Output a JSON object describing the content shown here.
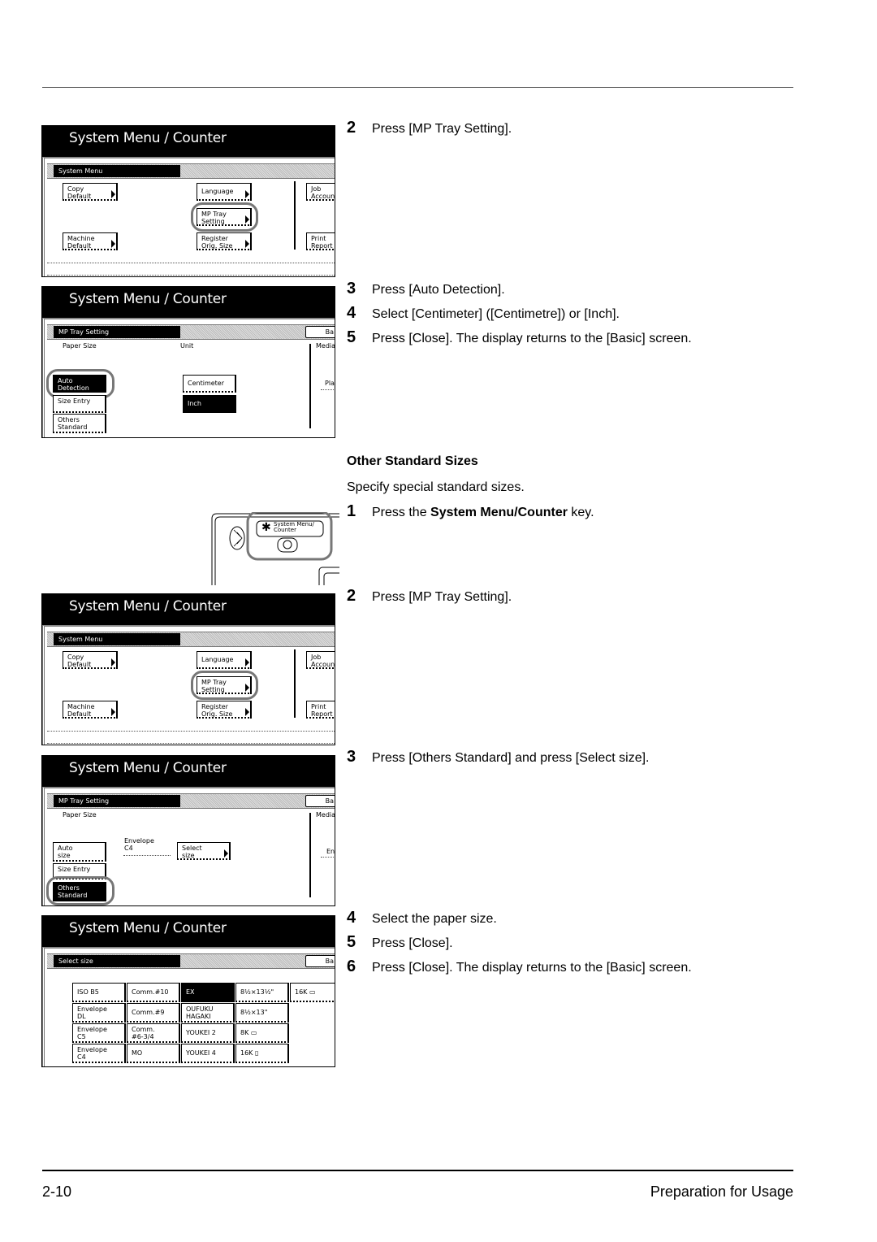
{
  "panel_title": "System Menu / Counter",
  "panel1": {
    "subbar": "System Menu",
    "buttons": {
      "copy_default": "Copy\nDefault",
      "language": "Language",
      "mp_tray": "MP Tray\nSetting",
      "machine_default": "Machine\nDefault",
      "register_orig": "Register\nOrig. Size",
      "job_account": "Job\nAccoun",
      "print_report": "Print\nReport"
    }
  },
  "panel2": {
    "subbar": "MP Tray Setting",
    "back": "Ba",
    "paper_size_label": "Paper Size",
    "unit_label": "Unit",
    "media_label": "Media",
    "plain_partial": "Pla",
    "buttons": {
      "auto_detection": "Auto\nDetection",
      "size_entry": "Size Entry",
      "others_standard": "Others\nStandard",
      "centimeter": "Centimeter",
      "inch": "Inch"
    }
  },
  "control_panel": {
    "key_label": "System Menu/\nCounter",
    "key_icon": "asterisk-icon"
  },
  "panel3": {
    "subbar": "System Menu",
    "buttons": {
      "copy_default": "Copy\nDefault",
      "language": "Language",
      "mp_tray": "MP Tray\nSetting",
      "machine_default": "Machine\nDefault",
      "register_orig": "Register\nOrig. Size",
      "job_account": "Job\nAccoun",
      "print_report": "Print\nReport"
    }
  },
  "panel4": {
    "subbar": "MP Tray Setting",
    "back": "Ba",
    "paper_size_label": "Paper Size",
    "media_label": "Media",
    "envelope_partial": "En",
    "current_size": "Envelope\nC4",
    "buttons": {
      "auto_size": "Auto\nsize",
      "size_entry": "Size Entry",
      "others_standard": "Others\nStandard",
      "select_size": "Select\nsize"
    }
  },
  "panel5": {
    "subbar": "Select size",
    "back": "Ba",
    "grid": [
      [
        "ISO B5",
        "Comm.#10",
        "EX",
        "8½×13½\"",
        "16K ▭"
      ],
      [
        "Envelope\nDL",
        "Comm.#9",
        "OUFUKU\nHAGAKI",
        "8½×13\"",
        ""
      ],
      [
        "Envelope\nC5",
        "Comm.\n#6-3/4",
        "YOUKEI 2",
        "8K ▭",
        ""
      ],
      [
        "Envelope\nC4",
        "MO",
        "YOUKEI 4",
        "16K ▯",
        ""
      ]
    ],
    "selected": "EX"
  },
  "steps_a": [
    {
      "num": "2",
      "text": "Press [MP Tray Setting]."
    },
    {
      "num": "3",
      "text": "Press [Auto Detection]."
    },
    {
      "num": "4",
      "text": "Select [Centimeter] ([Centimetre]) or [Inch]."
    },
    {
      "num": "5",
      "text": "Press [Close]. The display returns to the [Basic] screen."
    }
  ],
  "section": {
    "heading": "Other Standard Sizes",
    "intro": "Specify special standard sizes.",
    "step1_pre": "Press the ",
    "step1_bold": "System Menu/Counter",
    "step1_post": " key."
  },
  "steps_b": [
    {
      "num": "1",
      "text": ""
    },
    {
      "num": "2",
      "text": "Press [MP Tray Setting]."
    },
    {
      "num": "3",
      "text": "Press [Others Standard] and press [Select size]."
    },
    {
      "num": "4",
      "text": "Select the paper size."
    },
    {
      "num": "5",
      "text": "Press [Close]."
    },
    {
      "num": "6",
      "text": "Press [Close]. The display returns to the [Basic] screen."
    }
  ],
  "footer": {
    "page_number": "2-10",
    "chapter": "Preparation for Usage"
  }
}
